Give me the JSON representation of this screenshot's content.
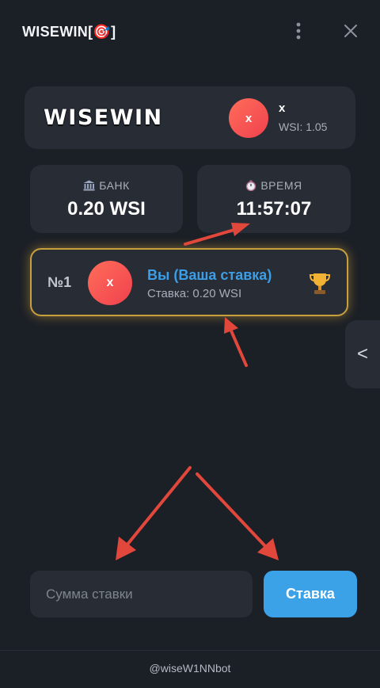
{
  "header": {
    "title": "WISEWIN[🎯]",
    "menu_icon": "more-vertical-icon",
    "close_icon": "close-icon"
  },
  "hero": {
    "brand": "WISEWIN",
    "avatar_letter": "x",
    "username": "x",
    "balance": "WSI: 1.05"
  },
  "stats": {
    "bank": {
      "label": "БАНК",
      "value": "0.20 WSI",
      "icon": "bank-icon"
    },
    "time": {
      "label": "ВРЕМЯ",
      "value": "11:57:07",
      "icon": "stopwatch-icon"
    }
  },
  "bets": [
    {
      "rank": "№1",
      "avatar_letter": "x",
      "name": "Вы (Ваша ставка)",
      "amount": "Ставка: 0.20 WSI",
      "icon": "trophy-icon"
    }
  ],
  "sidebar_toggle": {
    "label": "<"
  },
  "form": {
    "placeholder": "Сумма ставки",
    "value": "",
    "button_label": "Ставка"
  },
  "footer": {
    "text": "@wiseW1NNbot"
  },
  "colors": {
    "accent": "#3ba2e8",
    "highlight": "#c79f3d",
    "avatar": "#f0414e",
    "annotation": "#e2473b"
  }
}
